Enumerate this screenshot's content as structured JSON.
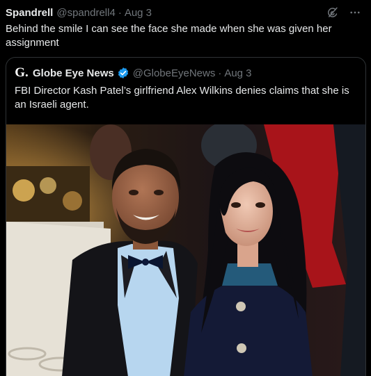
{
  "tweet": {
    "author_name": "Spandrell",
    "author_handle": "@spandrell4",
    "separator": "·",
    "date": "Aug 3",
    "text": "Behind the smile I can see the face she made when she was given her assignment",
    "icons": [
      "grok-icon",
      "more-icon"
    ]
  },
  "quoted": {
    "logo_letter": "G.",
    "author_name": "Globe Eye News",
    "verified": true,
    "author_handle": "@GlobeEyeNews",
    "separator": "·",
    "date": "Aug 3",
    "text": "FBI Director Kash Patel’s girlfriend Alex Wilkins denies claims that she is an Israeli agent.",
    "accent_color": "#1d9bf0"
  }
}
